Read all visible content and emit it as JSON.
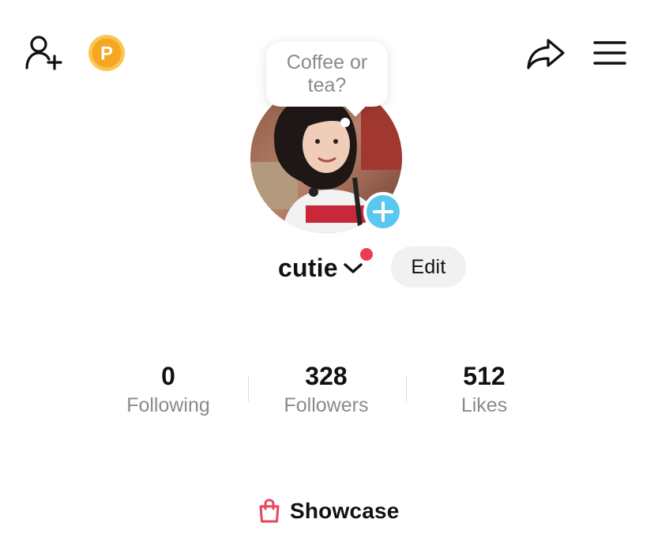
{
  "header": {
    "add_user_icon": "person-add-icon",
    "coins_icon": "coin-p-icon",
    "coin_letter": "P",
    "share_icon": "share-arrow-icon",
    "menu_icon": "hamburger-menu-icon"
  },
  "profile": {
    "note_bubble": "Coffee or tea?",
    "username": "cutie",
    "dropdown_icon": "chevron-down-icon",
    "edit_label": "Edit"
  },
  "stats": [
    {
      "value": "0",
      "label": "Following"
    },
    {
      "value": "328",
      "label": "Followers"
    },
    {
      "value": "512",
      "label": "Likes"
    }
  ],
  "showcase": {
    "label": "Showcase",
    "icon": "shopping-bag-icon"
  },
  "colors": {
    "coin": "#f5a623",
    "add_badge": "#58c8f0",
    "notification_dot": "#ee3b55",
    "showcase_bag": "#e8455a"
  }
}
